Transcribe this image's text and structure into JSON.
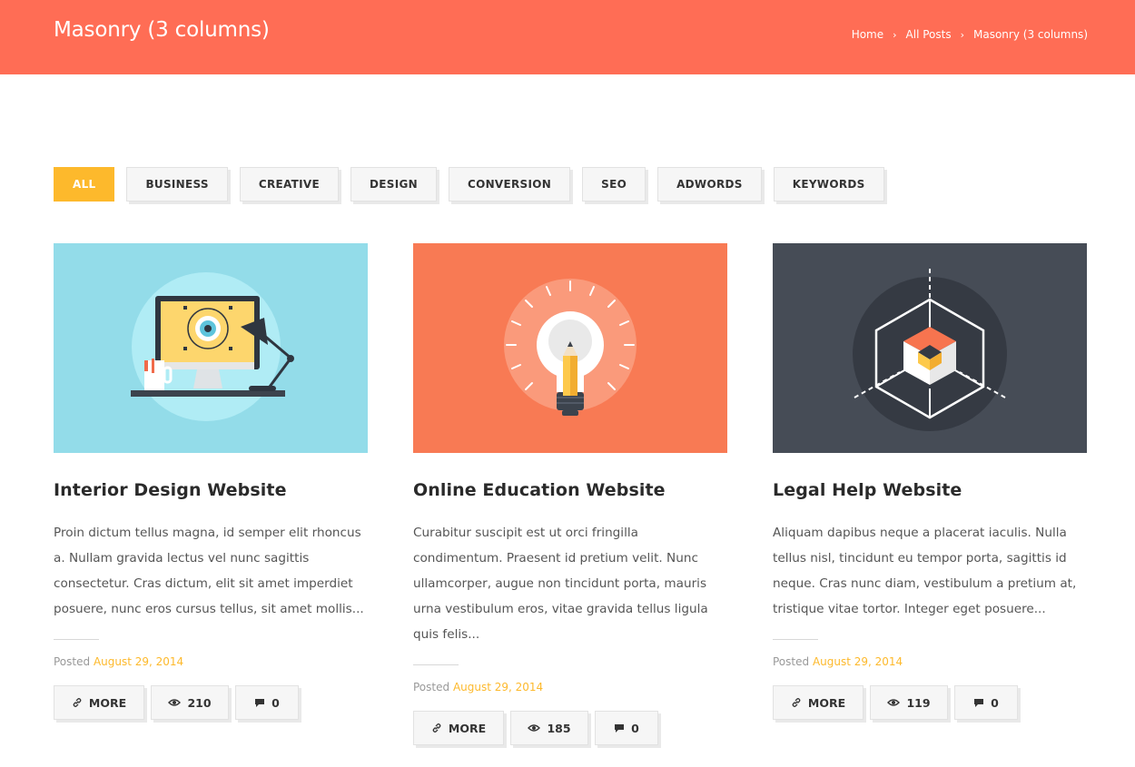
{
  "header": {
    "title": "Masonry (3 columns)",
    "breadcrumb": [
      "Home",
      "All Posts",
      "Masonry (3 columns)"
    ],
    "bg_color": "#ff6d55"
  },
  "filters": [
    {
      "label": "ALL",
      "active": true
    },
    {
      "label": "BUSINESS",
      "active": false
    },
    {
      "label": "CREATIVE",
      "active": false
    },
    {
      "label": "DESIGN",
      "active": false
    },
    {
      "label": "CONVERSION",
      "active": false
    },
    {
      "label": "SEO",
      "active": false
    },
    {
      "label": "ADWORDS",
      "active": false
    },
    {
      "label": "KEYWORDS",
      "active": false
    }
  ],
  "accent_color": "#fdb92c",
  "posts": [
    {
      "title": "Interior Design Website",
      "excerpt": "Proin dictum tellus magna, id semper elit rhoncus a. Nullam gravida lectus vel nunc sagittis consectetur. Cras dictum, elit sit amet imperdiet posuere, nunc eros cursus tellus, sit amet mollis...",
      "posted_label": "Posted",
      "date": "August 29, 2014",
      "more_label": "MORE",
      "views": "210",
      "comments": "0",
      "image": "desk-computer-illustration",
      "image_bg": "#93dce9"
    },
    {
      "title": "Online Education Website",
      "excerpt": "Curabitur suscipit est ut orci fringilla condimentum. Praesent id pretium velit. Nunc ullamcorper, augue non tincidunt porta, mauris urna vestibulum eros, vitae gravida tellus ligula quis felis...",
      "posted_label": "Posted",
      "date": "August 29, 2014",
      "more_label": "MORE",
      "views": "185",
      "comments": "0",
      "image": "lightbulb-pencil-illustration",
      "image_bg": "#f87a54"
    },
    {
      "title": "Legal Help Website",
      "excerpt": "Aliquam dapibus neque a placerat iaculis. Nulla tellus nisl, tincidunt eu tempor porta, sagittis id neque. Cras nunc diam, vestibulum a pretium at, tristique vitae tortor. Integer eget posuere...",
      "posted_label": "Posted",
      "date": "August 29, 2014",
      "more_label": "MORE",
      "views": "119",
      "comments": "0",
      "image": "cube-wireframe-illustration",
      "image_bg": "#464c56"
    }
  ]
}
